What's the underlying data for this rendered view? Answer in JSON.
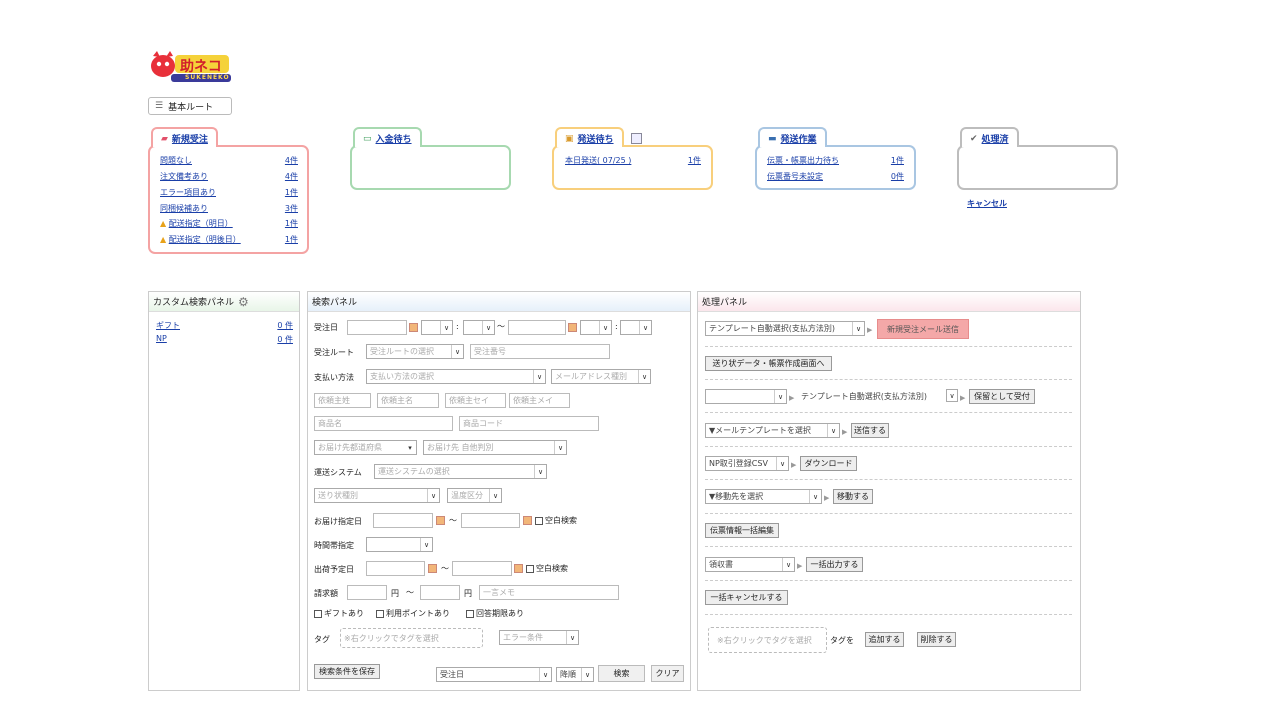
{
  "logo": {
    "main": "助ネコ",
    "sub": "SUKENEKO",
    "furigana": "すけ"
  },
  "route_button": {
    "label": "基本ルート"
  },
  "status": {
    "new_order": {
      "title": "新規受注",
      "color": "#f4a3a3",
      "rows": [
        {
          "label": "問題なし",
          "count": "4件",
          "warn": false
        },
        {
          "label": "注文備考あり",
          "count": "4件",
          "warn": false
        },
        {
          "label": "エラー項目あり",
          "count": "1件",
          "warn": false
        },
        {
          "label": "同梱候補あり",
          "count": "3件",
          "warn": false
        },
        {
          "label": "配送指定（明日）",
          "count": "1件",
          "warn": true
        },
        {
          "label": "配送指定（明後日）",
          "count": "1件",
          "warn": true
        }
      ]
    },
    "payment_wait": {
      "title": "入金待ち",
      "color": "#a7d9b0"
    },
    "ship_wait": {
      "title": "発送待ち",
      "color": "#f8cf7c",
      "rows": [
        {
          "label": "本日発送( 07/25 )",
          "count": "1件"
        }
      ]
    },
    "ship_work": {
      "title": "発送作業",
      "color": "#a9c6e2",
      "rows": [
        {
          "label": "伝票・帳票出力待ち",
          "count": "1件"
        },
        {
          "label": "伝票番号未設定",
          "count": "0件"
        }
      ]
    },
    "done": {
      "title": "処理済",
      "color": "#bdbdbd",
      "cancel": "キャンセル"
    }
  },
  "custom_panel": {
    "title": "カスタム検索パネル",
    "items": [
      {
        "label": "ギフト",
        "count": "0 件"
      },
      {
        "label": "NP",
        "count": "0 件"
      }
    ]
  },
  "search_panel": {
    "title": "検索パネル",
    "order_date": "受注日",
    "order_route": "受注ルート",
    "order_route_ph": "受注ルートの選択",
    "order_no_ph": "受注番号",
    "payment": "支払い方法",
    "payment_ph": "支払い方法の選択",
    "mail_type_ph": "メールアドレス種別",
    "name_ph": [
      "依頼主姓",
      "依頼主名",
      "依頼主セイ",
      "依頼主メイ"
    ],
    "product_name_ph": "商品名",
    "product_code_ph": "商品コード",
    "pref_ph": "お届け先都道府県",
    "ship_to_ph": "お届け先 自他判別",
    "ship_system": "運送システム",
    "ship_system_ph": "運送システムの選択",
    "slip_type_ph": "送り状種別",
    "temp_ph": "温度区分",
    "delivery_date": "お届け指定日",
    "blank_search": "空白検索",
    "time_slot": "時間帯指定",
    "ship_plan": "出荷予定日",
    "blank_search2": "空白検索",
    "amount": "請求額",
    "yen": "円",
    "tilde": "～",
    "memo_ph": "一言メモ",
    "gift": "ギフトあり",
    "points": "利用ポイントあり",
    "answer": "回答期限あり",
    "tag": "タグ",
    "tag_ph": "※右クリックでタグを選択",
    "error_cond": "エラー条件",
    "save": "検索条件を保存",
    "sort_field": "受注日",
    "sort_dir": "降順",
    "search": "検索",
    "clear": "クリア"
  },
  "process_panel": {
    "title": "処理パネル",
    "template_auto": "テンプレート自動選択(支払方法別)",
    "new_mail_send": "新規受注メール送信",
    "to_slip": "送り状データ・帳票作成画面へ",
    "template_auto2": "テンプレート自動選択(支払方法別)",
    "hold": "保留として受付",
    "mail_template": "▼メールテンプレートを選択",
    "send": "送信する",
    "np_csv": "NP取引登録CSV",
    "download": "ダウンロード",
    "move_to": "▼移動先を選択",
    "move": "移動する",
    "slip_edit": "伝票情報一括編集",
    "receipt": "領収書",
    "bulk_out": "一括出力する",
    "bulk_cancel": "一括キャンセルする",
    "tag_ph": "※右クリックでタグを選択",
    "tag_wo": "タグを",
    "add": "追加する",
    "remove": "削除する"
  }
}
